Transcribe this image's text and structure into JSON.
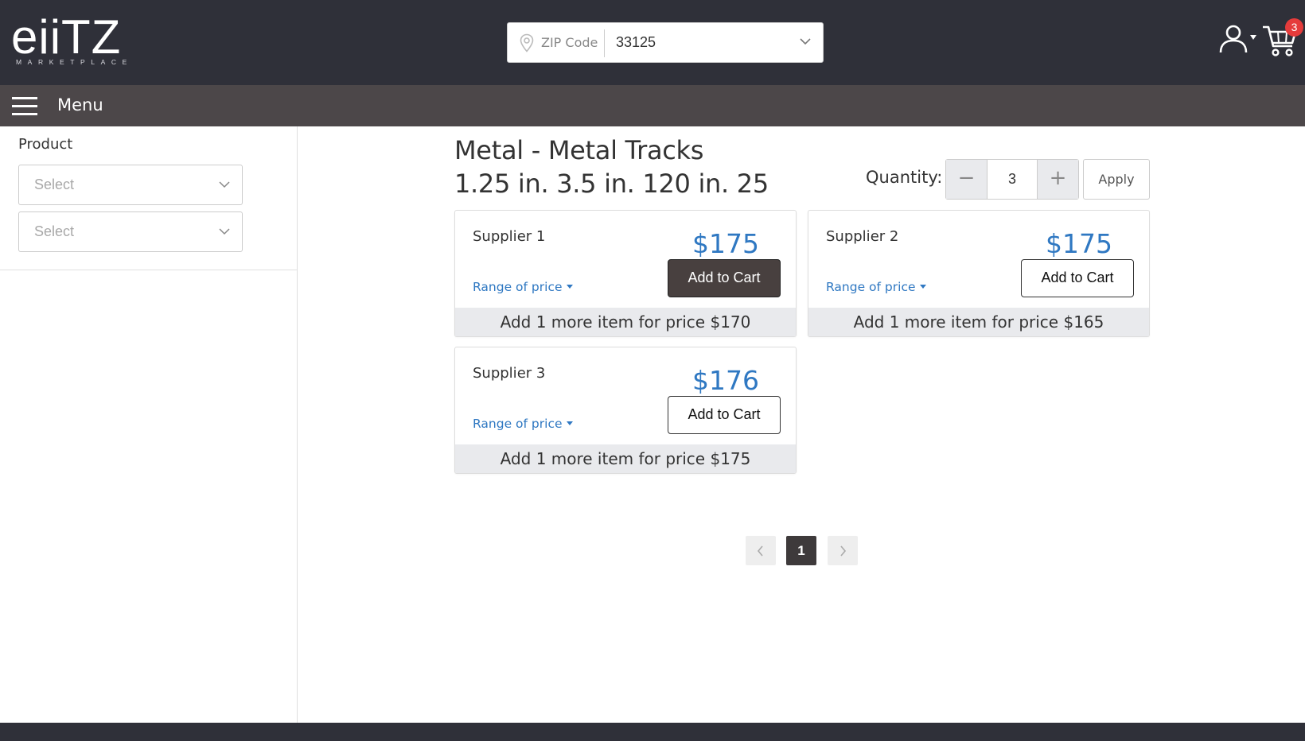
{
  "header": {
    "logo": {
      "word": "eiiTZ",
      "sub": "MARKETPLACE"
    },
    "zip": {
      "label": "ZIP Code",
      "value": "33125"
    },
    "cart_count": "3",
    "icons": [
      "map-pin-icon",
      "chevron-down-icon",
      "user-icon",
      "caret-down-icon",
      "shopping-cart-icon"
    ]
  },
  "menubar": {
    "label": "Menu"
  },
  "sidebar": {
    "filter_title": "Product",
    "selects": [
      {
        "placeholder": "Select"
      },
      {
        "placeholder": "Select"
      }
    ]
  },
  "product": {
    "title_line1": "Metal - Metal Tracks",
    "title_line2": "1.25 in. 3.5 in. 120 in. 25"
  },
  "quantity": {
    "label": "Quantity:",
    "minus": "−",
    "value": "3",
    "plus": "+",
    "apply_label": "Apply"
  },
  "suppliers": [
    {
      "name": "Supplier 1",
      "price": "$175",
      "add_label": "Add to Cart",
      "range_label": "Range of price",
      "footer": "Add 1 more item for price $170",
      "active": true
    },
    {
      "name": "Supplier 2",
      "price": "$175",
      "add_label": "Add to Cart",
      "range_label": "Range of price",
      "footer": "Add 1 more item for price $165",
      "active": false
    },
    {
      "name": "Supplier 3",
      "price": "$176",
      "add_label": "Add to Cart",
      "range_label": "Range of price",
      "footer": "Add 1 more item for price $175",
      "active": false
    }
  ],
  "pagination": {
    "current": "1"
  },
  "colors": {
    "header_bg": "#2f3039",
    "menubar_bg": "#4c4749",
    "price_blue": "#2f78c2",
    "badge_red": "#e53b3b",
    "active_button": "#48403f"
  }
}
